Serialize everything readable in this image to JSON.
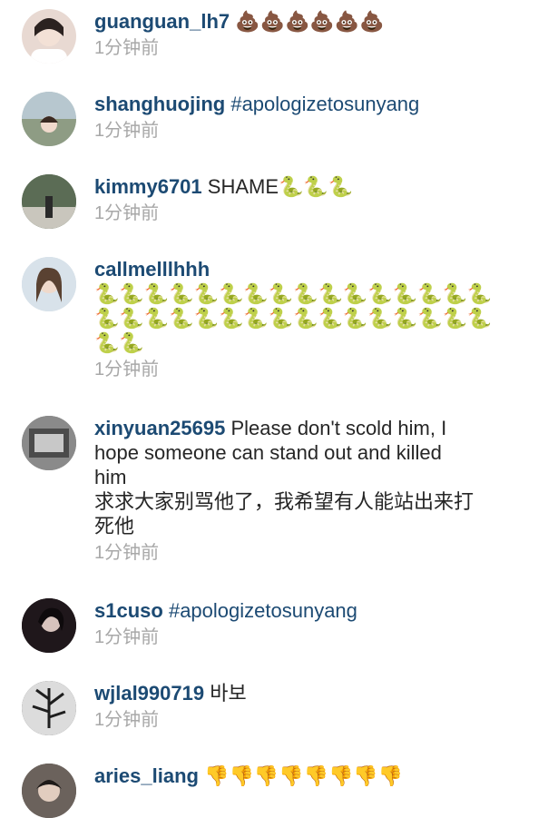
{
  "comments": [
    {
      "username": "guanguan_lh7",
      "emoji": "💩💩💩💩💩💩",
      "time": "1分钟前",
      "avatar_color": "#e8d9d2"
    },
    {
      "username": "shanghuojing",
      "text": "#apologizetosunyang",
      "time": "1分钟前",
      "avatar_color": "#bcc9c4"
    },
    {
      "username": "kimmy6701",
      "text": "SHAME",
      "emoji": "🐍🐍🐍",
      "time": "1分钟前",
      "avatar_color": "#6d7c63"
    },
    {
      "username": "callmelllhhh",
      "emoji_line1": "🐍🐍🐍🐍🐍🐍🐍🐍🐍🐍🐍🐍🐍🐍🐍🐍",
      "emoji_line2": "🐍🐍🐍🐍🐍🐍🐍🐍🐍🐍🐍🐍🐍🐍🐍🐍",
      "emoji_line3": "🐍🐍",
      "time": "1分钟前",
      "avatar_color": "#c9d6e0"
    },
    {
      "username": "xinyuan25695",
      "text_line1": "Please don't scold him, I",
      "text_line2": "hope someone can stand out and killed",
      "text_line3": "him",
      "text_line4": "求求大家别骂他了，我希望有人能站出来打",
      "text_line5": "死他",
      "time": "1分钟前",
      "avatar_color": "#7b7b7b"
    },
    {
      "username": "s1cuso",
      "text": "#apologizetosunyang",
      "time": "1分钟前",
      "avatar_color": "#2a1f24"
    },
    {
      "username": "wjlal990719",
      "text": "바보",
      "time": "1分钟前",
      "avatar_color": "#3a3a3a"
    },
    {
      "username": "aries_liang",
      "emoji": "👎👎👎👎👎👎👎👎",
      "avatar_color": "#5c5450"
    }
  ]
}
